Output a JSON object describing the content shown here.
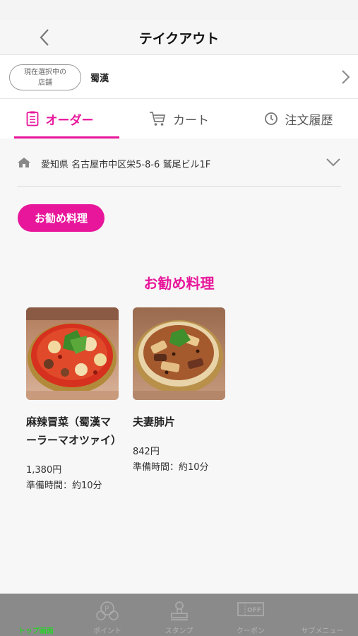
{
  "header": {
    "title": "テイクアウト"
  },
  "store": {
    "pill_label_line1": "現在選択中の",
    "pill_label_line2": "店舗",
    "name": "蜀漢"
  },
  "tabs": [
    {
      "label": "オーダー",
      "icon": "order-list-icon",
      "active": true
    },
    {
      "label": "カート",
      "icon": "cart-icon",
      "active": false
    },
    {
      "label": "注文履歴",
      "icon": "clock-icon",
      "active": false
    }
  ],
  "address": {
    "text": "愛知県 名古屋市中区栄5-8-6 鷲尾ビル1F"
  },
  "category_pill": {
    "label": "お勧め料理"
  },
  "section": {
    "title": "お勧め料理"
  },
  "items": [
    {
      "name": "麻辣冒菜（蜀漢マーラーマオツァイ）",
      "price": "1,380円",
      "prep": "準備時間：約10分"
    },
    {
      "name": "夫妻肺片",
      "price": "842円",
      "prep": "準備時間：約10分"
    }
  ],
  "bottom_nav": [
    {
      "label": "トップ画面",
      "icon": "home-icon",
      "active": true
    },
    {
      "label": "ポイント",
      "icon": "points-icon",
      "active": false
    },
    {
      "label": "スタンプ",
      "icon": "stamp-icon",
      "active": false
    },
    {
      "label": "クーポン",
      "icon": "coupon-icon",
      "active": false
    },
    {
      "label": "サブメニュー",
      "icon": "menu-icon",
      "active": false
    }
  ],
  "colors": {
    "accent": "#e8169b",
    "nav_active": "#2bd12b",
    "bottom_bar": "#8a8a8a"
  }
}
